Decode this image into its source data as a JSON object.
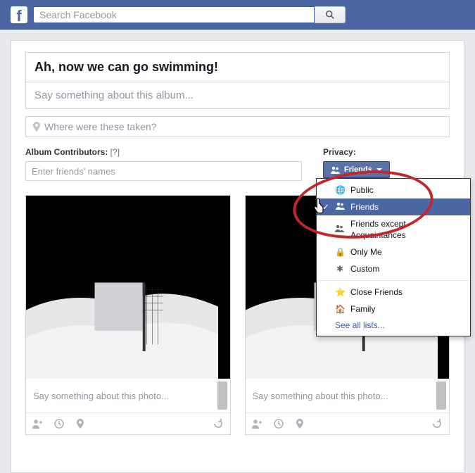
{
  "topbar": {
    "search_placeholder": "Search Facebook"
  },
  "album": {
    "title": "Ah, now we can go swimming!",
    "description_placeholder": "Say something about this album...",
    "location_placeholder": "Where were these taken?"
  },
  "contributors": {
    "label": "Album Contributors:",
    "help": "[?]",
    "placeholder": "Enter friends' names"
  },
  "privacy": {
    "label": "Privacy:",
    "selected": "Friends",
    "options": [
      {
        "icon": "globe",
        "label": "Public"
      },
      {
        "icon": "friends",
        "label": "Friends",
        "selected": true
      },
      {
        "icon": "friends-except",
        "label": "Friends except Acquaintances"
      },
      {
        "icon": "lock",
        "label": "Only Me"
      },
      {
        "icon": "gear",
        "label": "Custom"
      }
    ],
    "lists": [
      {
        "icon": "star",
        "label": "Close Friends"
      },
      {
        "icon": "house",
        "label": "Family"
      }
    ],
    "see_all": "See all lists..."
  },
  "photos": [
    {
      "caption_placeholder": "Say something about this photo..."
    },
    {
      "caption_placeholder": "Say something about this photo..."
    }
  ],
  "colors": {
    "fb_blue": "#4c66a4",
    "annotation": "#c1272d"
  }
}
